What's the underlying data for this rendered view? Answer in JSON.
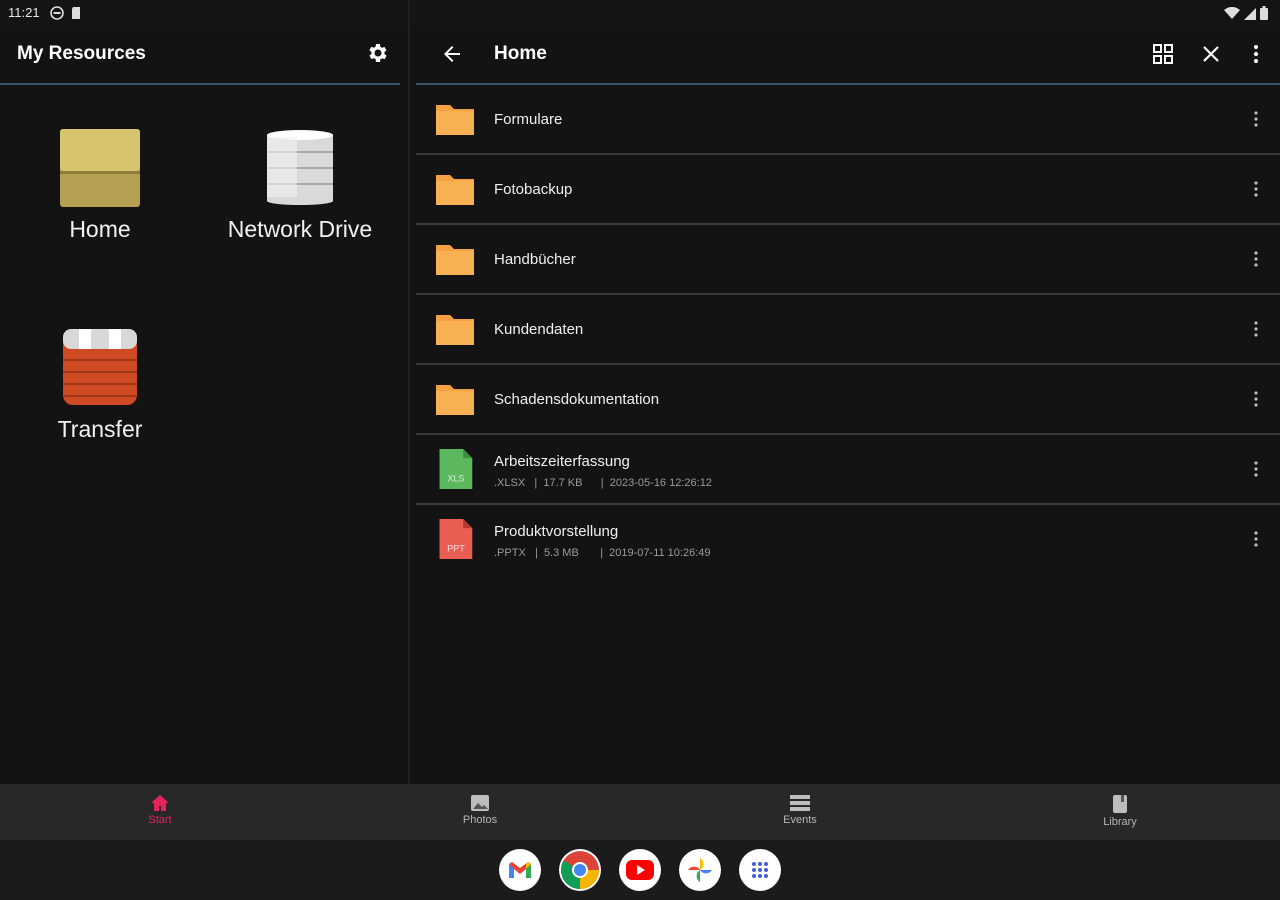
{
  "status_bar": {
    "time": "11:21"
  },
  "left_pane": {
    "title": "My Resources",
    "resources": [
      {
        "label": "Home",
        "icon": "home-box-icon"
      },
      {
        "label": "Network Drive",
        "icon": "database-icon"
      },
      {
        "label": "Transfer",
        "icon": "transfer-box-icon"
      }
    ]
  },
  "right_pane": {
    "title": "Home",
    "items": [
      {
        "name": "Formulare",
        "type": "folder"
      },
      {
        "name": "Fotobackup",
        "type": "folder"
      },
      {
        "name": "Handbücher",
        "type": "folder"
      },
      {
        "name": "Kundendaten",
        "type": "folder"
      },
      {
        "name": "Schadensdokumentation",
        "type": "folder"
      },
      {
        "name": "Arbeitszeiterfassung",
        "type": "file",
        "ext": ".XLSX",
        "size": "17.7 KB",
        "date": "2023-05-16 12:26:12",
        "badge": "XLS",
        "color": "#5cb85c"
      },
      {
        "name": "Produktvorstellung",
        "type": "file",
        "ext": ".PPTX",
        "size": "5.3 MB",
        "date": "2019-07-11 10:26:49",
        "badge": "PPT",
        "color": "#e95d52"
      }
    ]
  },
  "bottom_nav": [
    {
      "label": "Start",
      "active": true
    },
    {
      "label": "Photos",
      "active": false
    },
    {
      "label": "Events",
      "active": false
    },
    {
      "label": "Library",
      "active": false
    }
  ],
  "dock": [
    "gmail-icon",
    "chrome-icon",
    "youtube-icon",
    "photos-icon",
    "apps-grid-icon"
  ],
  "colors": {
    "accent": "#e2245a",
    "folder": "#f5a142",
    "divider": "#3d5568"
  }
}
